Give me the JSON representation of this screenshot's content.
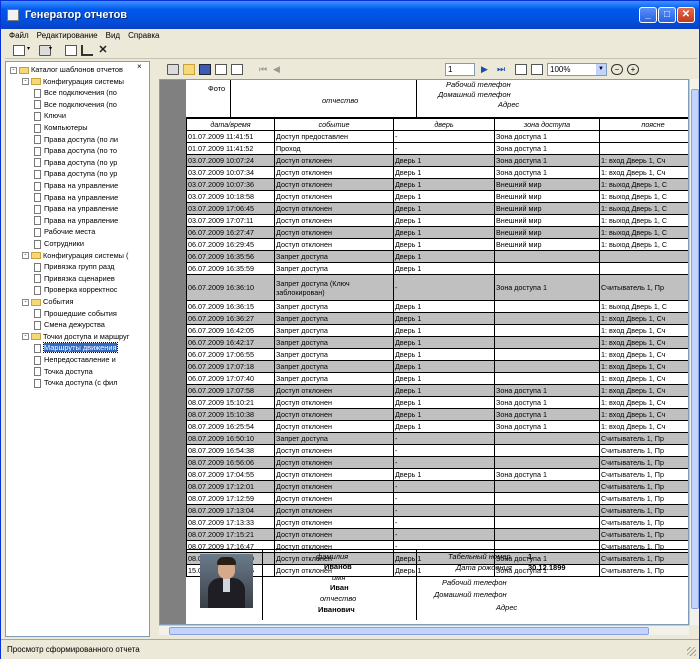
{
  "window": {
    "title": "Генератор отчетов",
    "minimize": "_",
    "maximize": "□",
    "close": "✕"
  },
  "menu": [
    "Файл",
    "Редактирование",
    "Вид",
    "Справка"
  ],
  "tree": {
    "close_glyph": "×",
    "items": [
      {
        "label": "Каталог шаблонов отчетов",
        "type": "folder",
        "expander": "-"
      },
      {
        "label": "Конфигурация системы",
        "type": "folder",
        "expander": "-"
      },
      {
        "label": "Все подключения (по",
        "type": "doc"
      },
      {
        "label": "Все подключения (по",
        "type": "doc"
      },
      {
        "label": "Ключи",
        "type": "doc"
      },
      {
        "label": "Компьютеры",
        "type": "doc"
      },
      {
        "label": "Права доступа (по ли",
        "type": "doc"
      },
      {
        "label": "Права доступа (по то",
        "type": "doc"
      },
      {
        "label": "Права доступа (по ур",
        "type": "doc"
      },
      {
        "label": "Права доступа (по ур",
        "type": "doc"
      },
      {
        "label": "Права на управление",
        "type": "doc"
      },
      {
        "label": "Права на управление",
        "type": "doc"
      },
      {
        "label": "Права на управление",
        "type": "doc"
      },
      {
        "label": "Права на управление",
        "type": "doc"
      },
      {
        "label": "Рабочие места",
        "type": "doc"
      },
      {
        "label": "Сотрудники",
        "type": "doc"
      },
      {
        "label": "Конфигурация системы (",
        "type": "folder",
        "expander": "-"
      },
      {
        "label": "Привязка групп разд",
        "type": "doc"
      },
      {
        "label": "Привязка сценариев",
        "type": "doc"
      },
      {
        "label": "Проверка корректнос",
        "type": "doc"
      },
      {
        "label": "События",
        "type": "folder",
        "expander": "-"
      },
      {
        "label": "Прошедшие события",
        "type": "doc"
      },
      {
        "label": "Смена дежурства",
        "type": "doc"
      },
      {
        "label": "Точки доступа и маршруг",
        "type": "folder",
        "expander": "-"
      },
      {
        "label": "Маршруты движения",
        "type": "doc",
        "selected": true
      },
      {
        "label": "Непредоставление и",
        "type": "doc"
      },
      {
        "label": "Точка доступа",
        "type": "doc"
      },
      {
        "label": "Точка доступа (с фил",
        "type": "doc"
      }
    ]
  },
  "viewer": {
    "page": "1",
    "zoom": "100%"
  },
  "report": {
    "top_card": {
      "photo_label": "Фото",
      "patronymic_label": "отчество",
      "work_phone_label": "Рабочий телефон",
      "home_phone_label": "Домашний телефон",
      "address_label": "Адрес"
    },
    "headers": [
      "дата/время",
      "событие",
      "дверь",
      "зона доступа",
      "поясне"
    ],
    "rows": [
      [
        "01.07.2009 11:41:51",
        "Доступ предоставлен",
        "-",
        "Зона доступа 1",
        "",
        false
      ],
      [
        "01.07.2009 11:41:52",
        "Проход",
        "-",
        "Зона доступа 1",
        "",
        false
      ],
      [
        "03.07.2009 10:07:24",
        "Доступ отклонен",
        "Дверь 1",
        "Зона доступа 1",
        "1: вход Дверь 1, Сч",
        true
      ],
      [
        "03.07.2009 10:07:34",
        "Доступ отклонен",
        "Дверь 1",
        "Зона доступа 1",
        "1: вход Дверь 1, Сч",
        false
      ],
      [
        "03.07.2009 10:07:36",
        "Доступ отклонен",
        "Дверь 1",
        "Внешний мир",
        "1: выход Дверь 1, С",
        true
      ],
      [
        "03.07.2009 10:18:58",
        "Доступ отклонен",
        "Дверь 1",
        "Внешний мир",
        "1: выход Дверь 1, С",
        false
      ],
      [
        "03.07.2009 17:06:45",
        "Доступ отклонен",
        "Дверь 1",
        "Внешний мир",
        "1: выход Дверь 1, С",
        true
      ],
      [
        "03.07.2009 17:07:11",
        "Доступ отклонен",
        "Дверь 1",
        "Внешний мир",
        "1: выход Дверь 1, С",
        false
      ],
      [
        "06.07.2009 16:27:47",
        "Доступ отклонен",
        "Дверь 1",
        "Внешний мир",
        "1: выход Дверь 1, С",
        true
      ],
      [
        "06.07.2009 16:29:45",
        "Доступ отклонен",
        "Дверь 1",
        "Внешний мир",
        "1: выход Дверь 1, С",
        false
      ],
      [
        "06.07.2009 16:35:56",
        "Запрет доступа",
        "Дверь 1",
        "",
        "",
        true
      ],
      [
        "06.07.2009 16:35:59",
        "Запрет доступа",
        "Дверь 1",
        "",
        "",
        false
      ],
      [
        "06.07.2009 16:36:10",
        "Запрет доступа (Ключ заблокирован)",
        "-",
        "Зона доступа 1",
        "Считыватель 1, Пр",
        true,
        true
      ],
      [
        "06.07.2009 16:36:15",
        "Запрет доступа",
        "Дверь 1",
        "",
        "1: выход Дверь 1, С",
        false
      ],
      [
        "06.07.2009 16:36:27",
        "Запрет доступа",
        "Дверь 1",
        "",
        "1: вход Дверь 1, Сч",
        true
      ],
      [
        "06.07.2009 16:42:05",
        "Запрет доступа",
        "Дверь 1",
        "",
        "1: вход Дверь 1, Сч",
        false
      ],
      [
        "06.07.2009 16:42:17",
        "Запрет доступа",
        "Дверь 1",
        "",
        "1: вход Дверь 1, Сч",
        true
      ],
      [
        "06.07.2009 17:06:55",
        "Запрет доступа",
        "Дверь 1",
        "",
        "1: вход Дверь 1, Сч",
        false
      ],
      [
        "06.07.2009 17:07:18",
        "Запрет доступа",
        "Дверь 1",
        "",
        "1: вход Дверь 1, Сч",
        true
      ],
      [
        "06.07.2009 17:07:40",
        "Запрет доступа",
        "Дверь 1",
        "",
        "1: вход Дверь 1, Сч",
        false
      ],
      [
        "06.07.2009 17:07:58",
        "Доступ отклонен",
        "Дверь 1",
        "Зона доступа 1",
        "1: вход Дверь 1, Сч",
        true
      ],
      [
        "08.07.2009 15:10:21",
        "Доступ отклонен",
        "Дверь 1",
        "Зона доступа 1",
        "1: вход Дверь 1, Сч",
        false
      ],
      [
        "08.07.2009 15:10:38",
        "Доступ отклонен",
        "Дверь 1",
        "Зона доступа 1",
        "1: вход Дверь 1, Сч",
        true
      ],
      [
        "08.07.2009 16:25:54",
        "Доступ отклонен",
        "Дверь 1",
        "Зона доступа 1",
        "1: вход Дверь 1, Сч",
        false
      ],
      [
        "08.07.2009 16:50:10",
        "Запрет доступа",
        "-",
        "",
        "Считыватель 1, Пр",
        true
      ],
      [
        "08.07.2009 16:54:38",
        "Доступ отклонен",
        "-",
        "",
        "Считыватель 1, Пр",
        false
      ],
      [
        "08.07.2009 16:56:06",
        "Доступ отклонен",
        "-",
        "",
        "Считыватель 1, Пр",
        true
      ],
      [
        "08.07.2009 17:04:55",
        "Доступ отклонен",
        "Дверь 1",
        "Зона доступа 1",
        "Считыватель 1, Пр",
        false
      ],
      [
        "08.07.2009 17:12:01",
        "Доступ отклонен",
        "-",
        "",
        "Считыватель 1, Пр",
        true
      ],
      [
        "08.07.2009 17:12:59",
        "Доступ отклонен",
        "-",
        "",
        "Считыватель 1, Пр",
        false
      ],
      [
        "08.07.2009 17:13:04",
        "Доступ отклонен",
        "-",
        "",
        "Считыватель 1, Пр",
        true
      ],
      [
        "08.07.2009 17:13:33",
        "Доступ отклонен",
        "-",
        "",
        "Считыватель 1, Пр",
        false
      ],
      [
        "08.07.2009 17:15:21",
        "Доступ отклонен",
        "-",
        "",
        "Считыватель 1, Пр",
        true
      ],
      [
        "08.07.2009 17:16:47",
        "Доступ отклонен",
        "-",
        "",
        "Считыватель 1, Пр",
        false
      ],
      [
        "08.07.2009 17:18:59",
        "Доступ отклонен",
        "Дверь 1",
        "Зона доступа 1",
        "Считыватель 1, Пр",
        true
      ],
      [
        "15.07.2009 15:31:36",
        "Доступ отклонен",
        "Дверь 1",
        "Зона доступа 1",
        "Считыватель 1, Пр",
        false
      ]
    ],
    "bottom_card": {
      "surname_label": "фамилия",
      "surname": "Иванов",
      "name_label": "имя",
      "name": "Иван",
      "patronymic_label": "отчество",
      "patronymic": "Иванович",
      "tab_label": "Табельный номер",
      "tab_value": "1",
      "birth_label": "Дата рождения",
      "birth_value": "30.12.1899",
      "work_phone_label": "Рабочий телефон",
      "home_phone_label": "Домашний телефон",
      "address_label": "Адрес"
    }
  },
  "status": "Просмотр сформированного отчета"
}
